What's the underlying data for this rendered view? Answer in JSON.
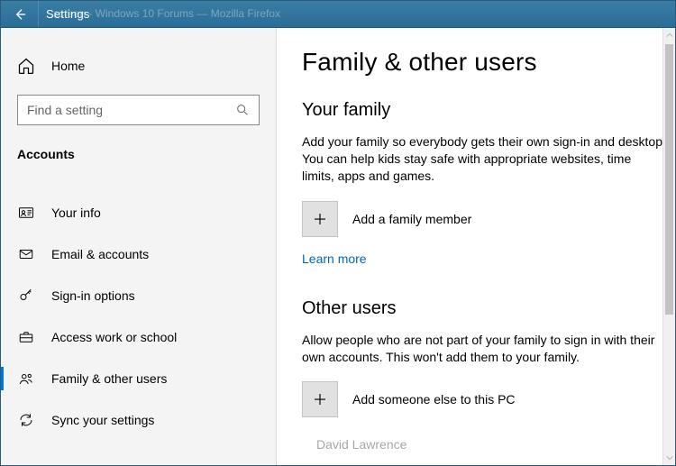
{
  "titlebar": {
    "app_title": "Settings",
    "background_hint": "screen - Windows 10 Forums — Mozilla Firefox"
  },
  "sidebar": {
    "home_label": "Home",
    "search_placeholder": "Find a setting",
    "section_label": "Accounts",
    "items": [
      {
        "label": "Your info"
      },
      {
        "label": "Email & accounts"
      },
      {
        "label": "Sign-in options"
      },
      {
        "label": "Access work or school"
      },
      {
        "label": "Family & other users"
      },
      {
        "label": "Sync your settings"
      }
    ]
  },
  "main": {
    "page_title": "Family & other users",
    "section1_heading": "Your family",
    "section1_desc": "Add your family so everybody gets their own sign-in and desktop. You can help kids stay safe with appropriate websites, time limits, apps and games.",
    "add_family_label": "Add a family member",
    "learn_more": "Learn more",
    "section2_heading": "Other users",
    "section2_desc": "Allow people who are not part of your family to sign in with their own accounts. This won't add them to your family.",
    "add_other_label": "Add someone else to this PC",
    "partial_user": "David Lawrence"
  }
}
